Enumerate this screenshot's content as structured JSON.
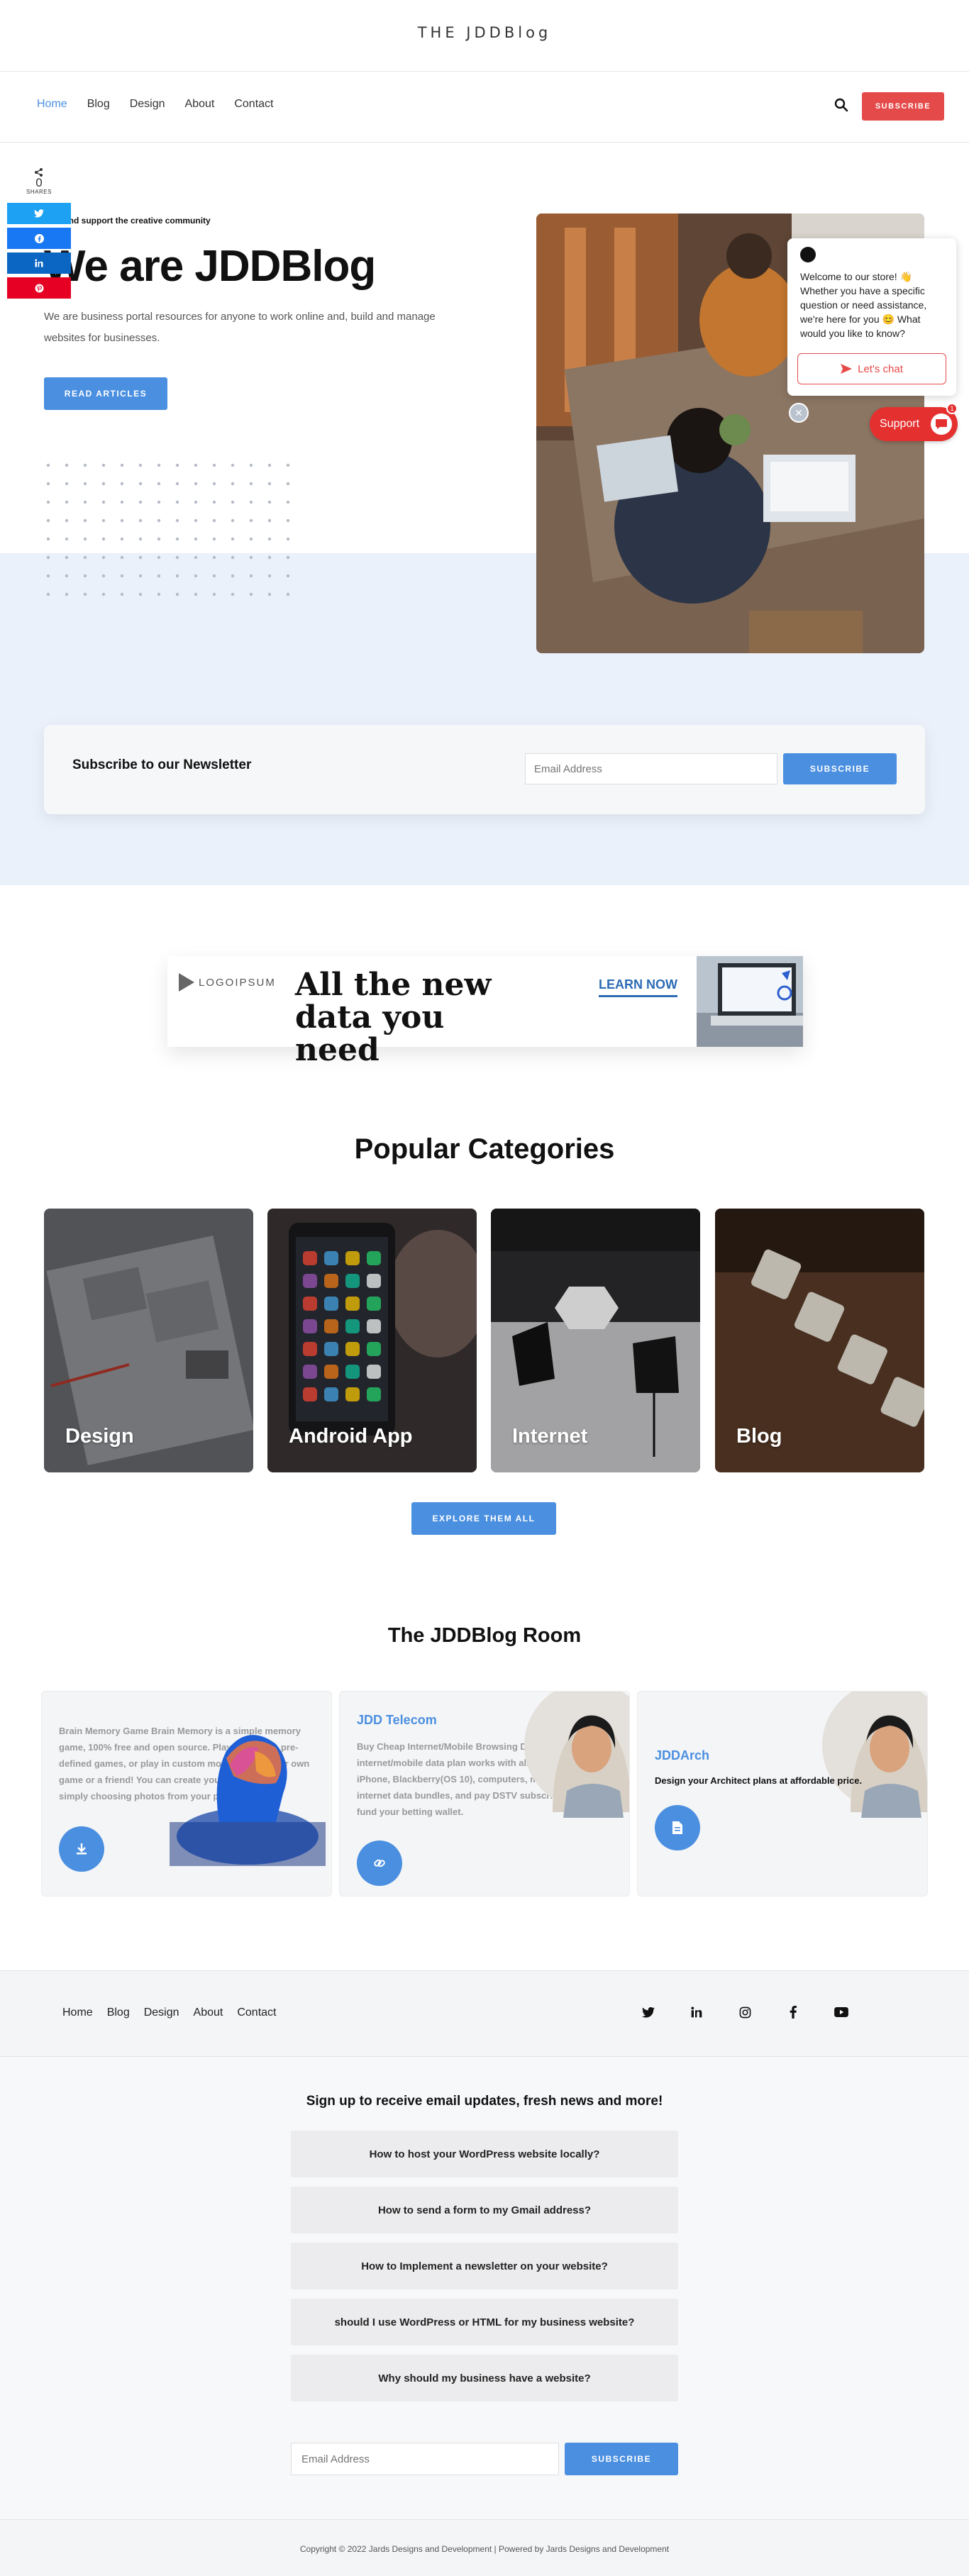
{
  "site": {
    "title": "THE JDDBlog"
  },
  "nav": {
    "items": [
      "Home",
      "Blog",
      "Design",
      "About",
      "Contact"
    ],
    "active": "Home"
  },
  "header": {
    "subscribe_label": "SUBSCRIBE",
    "search_icon": "search-icon"
  },
  "share": {
    "count": "0",
    "label": "SHARES",
    "networks": [
      "twitter",
      "facebook",
      "linkedin",
      "pinterest"
    ]
  },
  "hero": {
    "tagline": "Join and support the creative community",
    "title": "We are JDDBlog",
    "description": "We are business portal resources for anyone to work online and, build and manage websites for businesses.",
    "cta_label": "READ ARTICLES"
  },
  "chat": {
    "welcome": "Welcome to our store! 👋 Whether you have a specific question or need assistance, we're here for you 😊 What would you like to know?",
    "button_label": "Let's chat",
    "support_label": "Support",
    "badge": "1"
  },
  "newsletter": {
    "title": "Subscribe to our Newsletter",
    "placeholder": "Email Address",
    "button_label": "SUBSCRIBE"
  },
  "ad": {
    "logo_text": "LOGOIPSUM",
    "headline": "All the new data you need",
    "cta": "LEARN NOW"
  },
  "categories": {
    "title": "Popular Categories",
    "items": [
      "Design",
      "Android App",
      "Internet",
      "Blog"
    ],
    "explore_label": "EXPLORE THEM ALL"
  },
  "room": {
    "title": "The JDDBlog Room",
    "cards": [
      {
        "heading": "",
        "description": "Brain Memory Game Brain Memory is a simple memory game, 100% free and open source. Play one of the pre-defined games, or play in custom mode. Create your own game or a friend! You can create your own mode by simply choosing photos from your phone."
      },
      {
        "heading": "JDD Telecom",
        "description": "Buy Cheap Internet/Mobile Browsing Data bundle internet/mobile data plan works with all devices: Android, iPhone, Blackberry(OS 10), computers, modems e.t.c. Buy internet data bundles, and pay DSTV subscriptions and fund your betting wallet."
      },
      {
        "heading": "JDDArch",
        "description": "Design your Architect plans at affordable price."
      }
    ]
  },
  "footer": {
    "nav": [
      "Home",
      "Blog",
      "Design",
      "About",
      "Contact"
    ],
    "social": [
      "twitter-icon",
      "linkedin-icon",
      "instagram-icon",
      "facebook-icon",
      "youtube-icon"
    ],
    "signup_title": "Sign up to receive email updates, fresh news and more!",
    "faq": [
      "How to host your WordPress website locally?",
      "How to send a form to my Gmail address?",
      "How to Implement a newsletter on your website?",
      "should I use WordPress or HTML for my business website?",
      "Why should my business have a website?"
    ],
    "email_placeholder": "Email Address",
    "subscribe_label": "SUBSCRIBE",
    "copyright": "Copyright © 2022 Jards Designs and Development | Powered by Jards Designs and Development"
  },
  "colors": {
    "accent": "#4a8fe0",
    "brand_red": "#e54a4a",
    "hero_band": "#eaf1fb"
  }
}
